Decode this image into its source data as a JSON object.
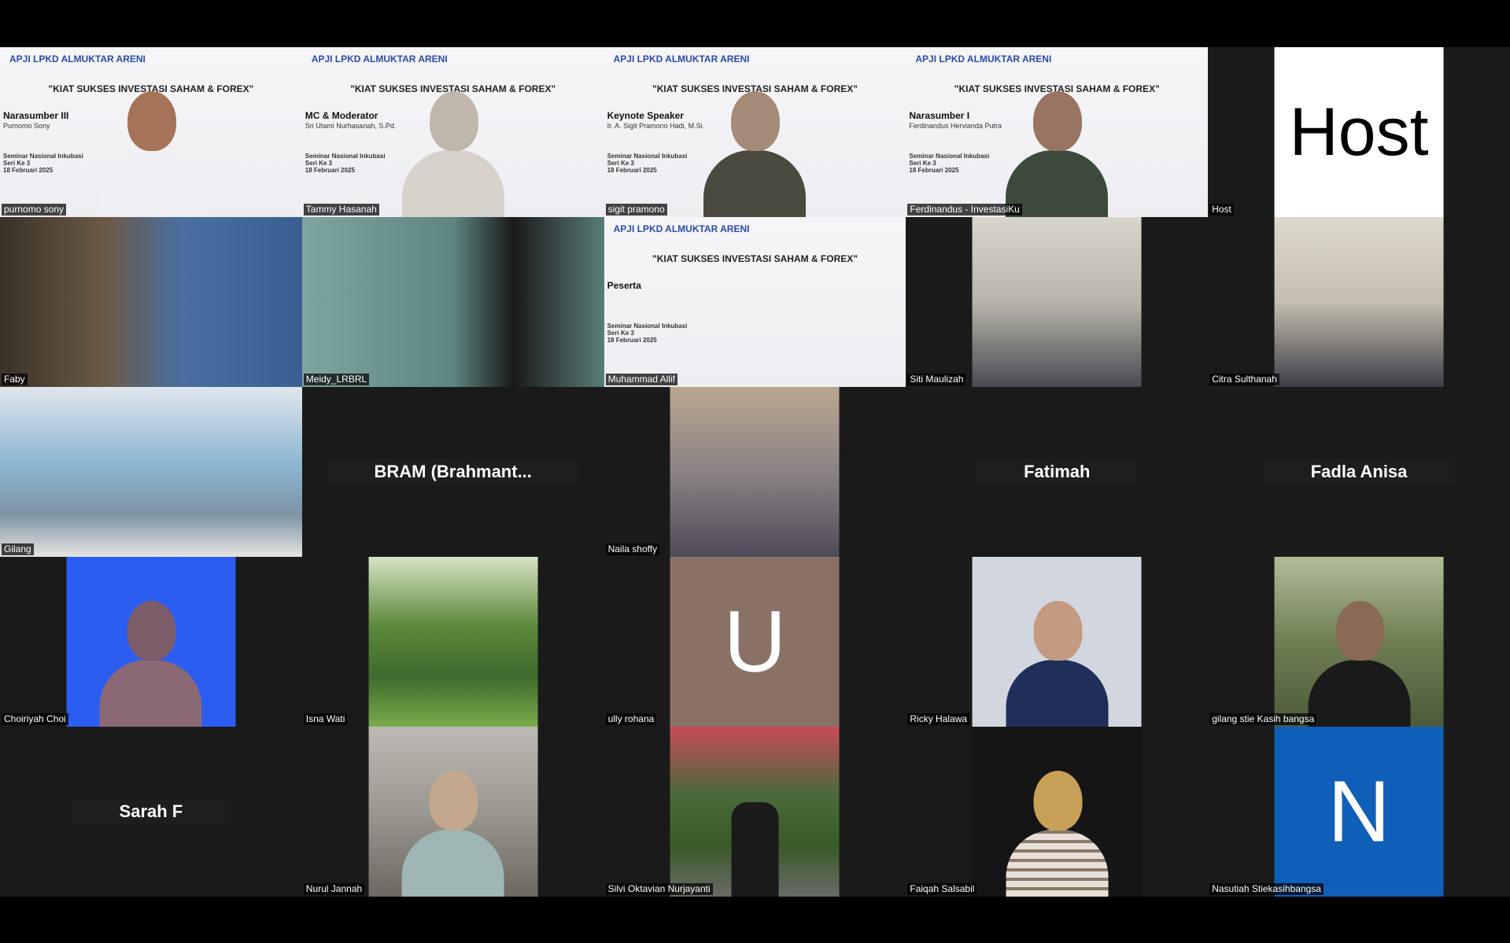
{
  "slide": {
    "logos": "APJI  LPKD  ALMUKTAR  ARENI",
    "slogan": "\"KIAT SUKSES INVESTASI SAHAM & FOREX\"",
    "seminar": "Seminar Nasional Inkubasi",
    "seri": "Seri Ke 3",
    "date": "18 Februari 2025"
  },
  "tiles": [
    {
      "name": "purnomo sony",
      "role": "Narasumber III",
      "sub": "Purnomo Sony"
    },
    {
      "name": "Tammy Hasanah",
      "role": "MC & Moderator",
      "sub": "Sri Utami Nurhasanah, S.Pd."
    },
    {
      "name": "sigit pramono",
      "role": "Keynote Speaker",
      "sub": "Ir. A. Sigit Pramono Hadi, M.Si."
    },
    {
      "name": "Ferdinandus - InvestasiKu",
      "role": "Narasumber I",
      "sub": "Ferdinandus Hervianda Putra"
    },
    {
      "name": "Host",
      "display": "Host"
    },
    {
      "name": "Faby"
    },
    {
      "name": "Meidy_LRBRL"
    },
    {
      "name": "Muhammad Allif",
      "role": "Peserta"
    },
    {
      "name": "Siti Maulizah"
    },
    {
      "name": "Citra Sulthanah"
    },
    {
      "name": "Gilang"
    },
    {
      "display": "BRAM  (Brahmant..."
    },
    {
      "name": "Naila shoffy"
    },
    {
      "display": "Fatimah"
    },
    {
      "display": "Fadla Anisa"
    },
    {
      "name": "Choiriyah Choi"
    },
    {
      "name": "Isna Wati"
    },
    {
      "name": "ully rohana",
      "display": "U"
    },
    {
      "name": "Ricky Halawa"
    },
    {
      "name": "gilang stie Kasih bangsa"
    },
    {
      "display": "Sarah F"
    },
    {
      "name": "Nurul Jannah"
    },
    {
      "name": "Silvi Oktavian Nurjayanti"
    },
    {
      "name": "Faiqah Salsabil"
    },
    {
      "name": "Nasutiah Stiekasihbangsa",
      "display": "N"
    }
  ]
}
